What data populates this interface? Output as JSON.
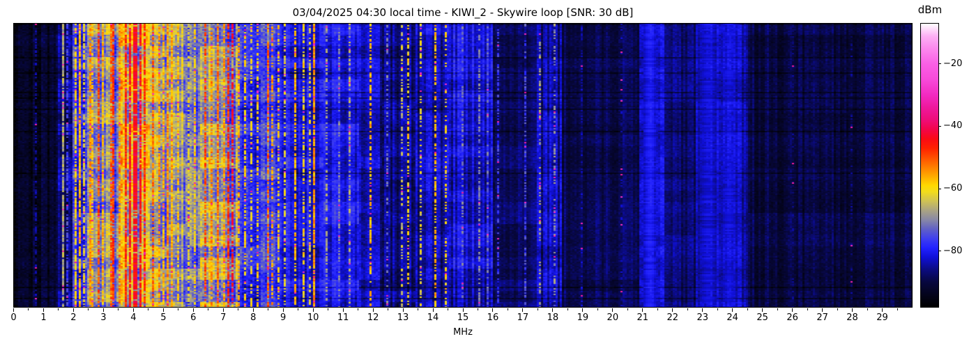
{
  "figure": {
    "title": "03/04/2025 04:30 local time - KIWI_2 - Skywire loop [SNR: 30 dB]"
  },
  "chart_data": {
    "type": "heatmap",
    "subtype": "radio-spectrum-waterfall",
    "title": "03/04/2025 04:30 local time - KIWI_2 - Skywire loop [SNR: 30 dB]",
    "xlabel": "MHz",
    "xlim": [
      0,
      30
    ],
    "x_major_ticks": [
      0,
      1,
      2,
      3,
      4,
      5,
      6,
      7,
      8,
      9,
      10,
      11,
      12,
      13,
      14,
      15,
      16,
      17,
      18,
      19,
      20,
      21,
      22,
      23,
      24,
      25,
      26,
      27,
      28,
      29
    ],
    "x_minor_tick_step": 0.5,
    "y_ticks": [],
    "colorbar": {
      "label": "dBm",
      "ticks": [
        -20,
        -40,
        -60,
        -80
      ],
      "vmax": -7,
      "vmin": -98
    },
    "colormap_stops": [
      [
        -98,
        "#000000"
      ],
      [
        -94,
        "#04041c"
      ],
      [
        -90,
        "#07073e"
      ],
      [
        -86,
        "#0b0b80"
      ],
      [
        -82,
        "#1010d8"
      ],
      [
        -79,
        "#2222ff"
      ],
      [
        -76,
        "#3f3fee"
      ],
      [
        -73,
        "#6060c6"
      ],
      [
        -70,
        "#8888a6"
      ],
      [
        -67,
        "#aaa383"
      ],
      [
        -64,
        "#cfc254"
      ],
      [
        -61,
        "#f2dc1c"
      ],
      [
        -59,
        "#ffd900"
      ],
      [
        -56,
        "#ffaa00"
      ],
      [
        -53,
        "#ff7d00"
      ],
      [
        -50,
        "#ff4f00"
      ],
      [
        -47,
        "#ff2200"
      ],
      [
        -44,
        "#fa0a15"
      ],
      [
        -41,
        "#f30549"
      ],
      [
        -38,
        "#ee0d77"
      ],
      [
        -34,
        "#ee189c"
      ],
      [
        -30,
        "#f22ac0"
      ],
      [
        -25,
        "#f74ad9"
      ],
      [
        -20,
        "#fa5fe5"
      ],
      [
        -15,
        "#fc88ed"
      ],
      [
        -11,
        "#fdb0f4"
      ],
      [
        -7,
        "#ffffff"
      ]
    ],
    "bands_format": [
      "from_mhz",
      "to_mhz",
      "mean_level_dbm",
      "speckle_db",
      "activity"
    ],
    "bands": [
      [
        0.0,
        1.45,
        -93,
        4,
        0.2
      ],
      [
        1.45,
        1.95,
        -86,
        4,
        0.5
      ],
      [
        1.95,
        2.45,
        -79,
        6,
        0.7
      ],
      [
        2.45,
        3.55,
        -70,
        7,
        0.9
      ],
      [
        3.55,
        4.55,
        -64,
        8,
        1.0
      ],
      [
        4.55,
        5.1,
        -69,
        7,
        0.9
      ],
      [
        5.1,
        5.7,
        -67,
        7,
        0.9
      ],
      [
        5.7,
        6.25,
        -75,
        7,
        0.7
      ],
      [
        6.25,
        7.55,
        -68,
        8,
        0.9
      ],
      [
        7.55,
        8.25,
        -77,
        6,
        0.6
      ],
      [
        8.25,
        8.9,
        -74,
        7,
        0.7
      ],
      [
        8.9,
        10.35,
        -81,
        4,
        0.5
      ],
      [
        10.35,
        11.5,
        -80,
        4,
        0.5
      ],
      [
        11.5,
        12.3,
        -84,
        4,
        0.4
      ],
      [
        12.3,
        13.4,
        -86,
        4,
        0.35
      ],
      [
        13.4,
        14.5,
        -84,
        4,
        0.4
      ],
      [
        14.5,
        16.0,
        -82,
        4,
        0.45
      ],
      [
        16.0,
        17.5,
        -87,
        3,
        0.3
      ],
      [
        17.5,
        18.3,
        -85,
        4,
        0.35
      ],
      [
        18.3,
        20.9,
        -89,
        3,
        0.25
      ],
      [
        20.9,
        21.7,
        -83,
        3,
        0.3
      ],
      [
        21.7,
        22.8,
        -87,
        3,
        0.25
      ],
      [
        22.8,
        24.5,
        -84,
        3,
        0.3
      ],
      [
        24.5,
        30.0,
        -90,
        3,
        0.2
      ]
    ],
    "lines_format": [
      "freq_mhz",
      "peak_level_dbm",
      "halfwidth_mhz",
      "persistence"
    ],
    "lines": [
      [
        0.75,
        -86,
        0.03,
        0.6
      ],
      [
        1.62,
        -67,
        0.03,
        0.9
      ],
      [
        1.8,
        -76,
        0.03,
        0.7
      ],
      [
        2.06,
        -60,
        0.03,
        0.8
      ],
      [
        2.17,
        -57,
        0.03,
        0.9
      ],
      [
        2.35,
        -62,
        0.03,
        0.7
      ],
      [
        2.52,
        -54,
        0.03,
        0.8
      ],
      [
        2.65,
        -58,
        0.03,
        0.7
      ],
      [
        2.82,
        -50,
        0.04,
        0.75
      ],
      [
        3.0,
        -56,
        0.03,
        0.7
      ],
      [
        3.22,
        -51,
        0.04,
        0.8
      ],
      [
        3.35,
        -48,
        0.03,
        0.8
      ],
      [
        3.5,
        -53,
        0.03,
        0.7
      ],
      [
        3.72,
        -47,
        0.04,
        0.85
      ],
      [
        3.88,
        -45,
        0.05,
        0.9
      ],
      [
        4.05,
        -44,
        0.05,
        0.9
      ],
      [
        4.22,
        -45,
        0.04,
        0.85
      ],
      [
        4.38,
        -47,
        0.04,
        0.8
      ],
      [
        4.65,
        -52,
        0.03,
        0.75
      ],
      [
        4.85,
        -55,
        0.03,
        0.7
      ],
      [
        5.0,
        -57,
        0.03,
        0.8
      ],
      [
        5.15,
        -54,
        0.03,
        0.8
      ],
      [
        5.3,
        -56,
        0.03,
        0.75
      ],
      [
        5.5,
        -58,
        0.03,
        0.7
      ],
      [
        5.85,
        -62,
        0.03,
        0.6
      ],
      [
        6.05,
        -59,
        0.03,
        0.65
      ],
      [
        6.4,
        -50,
        0.04,
        0.8
      ],
      [
        6.6,
        -54,
        0.03,
        0.7
      ],
      [
        6.8,
        -52,
        0.03,
        0.75
      ],
      [
        7.0,
        -55,
        0.03,
        0.7
      ],
      [
        7.18,
        -48,
        0.04,
        0.8
      ],
      [
        7.33,
        -44,
        0.04,
        0.65
      ],
      [
        7.5,
        -56,
        0.03,
        0.6
      ],
      [
        7.7,
        -59,
        0.03,
        0.6
      ],
      [
        7.9,
        -61,
        0.03,
        0.55
      ],
      [
        8.15,
        -58,
        0.03,
        0.5
      ],
      [
        8.47,
        -51,
        0.04,
        0.55
      ],
      [
        8.65,
        -55,
        0.03,
        0.5
      ],
      [
        8.85,
        -59,
        0.03,
        0.5
      ],
      [
        9.05,
        -62,
        0.03,
        0.5
      ],
      [
        9.4,
        -57,
        0.03,
        0.7
      ],
      [
        9.65,
        -60,
        0.03,
        0.6
      ],
      [
        9.9,
        -63,
        0.03,
        0.5
      ],
      [
        10.0,
        -55,
        0.03,
        0.9
      ],
      [
        10.45,
        -68,
        0.03,
        0.5
      ],
      [
        10.85,
        -70,
        0.03,
        0.45
      ],
      [
        11.2,
        -66,
        0.03,
        0.45
      ],
      [
        11.9,
        -57,
        0.03,
        0.55
      ],
      [
        12.5,
        -72,
        0.03,
        0.4
      ],
      [
        12.95,
        -64,
        0.03,
        0.45
      ],
      [
        13.15,
        -60,
        0.03,
        0.5
      ],
      [
        13.6,
        -62,
        0.03,
        0.45
      ],
      [
        14.05,
        -57,
        0.03,
        0.55
      ],
      [
        14.45,
        -60,
        0.03,
        0.45
      ],
      [
        15.0,
        -72,
        0.03,
        0.4
      ],
      [
        15.55,
        -71,
        0.06,
        0.6
      ],
      [
        15.8,
        -73,
        0.04,
        0.5
      ],
      [
        16.2,
        -77,
        0.03,
        0.5
      ],
      [
        17.1,
        -75,
        0.03,
        0.45
      ],
      [
        17.6,
        -68,
        0.03,
        0.4
      ],
      [
        18.05,
        -70,
        0.03,
        0.45
      ],
      [
        19.0,
        -85,
        0.04,
        0.5
      ],
      [
        20.3,
        -86,
        0.03,
        0.4
      ],
      [
        21.25,
        -80,
        0.25,
        0.9
      ],
      [
        23.2,
        -82,
        0.35,
        0.9
      ],
      [
        23.9,
        -82,
        0.3,
        0.9
      ],
      [
        26.0,
        -88,
        0.04,
        0.4
      ],
      [
        28.0,
        -88,
        0.04,
        0.4
      ]
    ]
  }
}
